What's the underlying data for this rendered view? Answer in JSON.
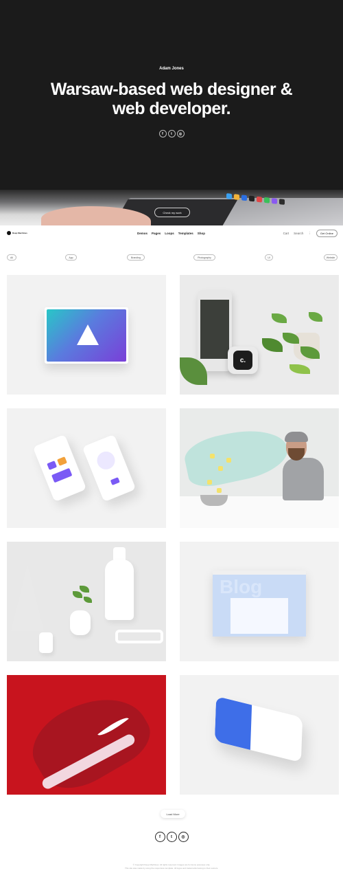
{
  "hero": {
    "name": "Adam Jones",
    "title_line1": "Warsaw-based web designer &",
    "title_line2": "web developer.",
    "social": [
      {
        "icon": "facebook-icon",
        "glyph": "f"
      },
      {
        "icon": "twitter-icon",
        "glyph": "t"
      },
      {
        "icon": "dribbble-icon",
        "glyph": "◎"
      }
    ],
    "cta_label": "Check my work"
  },
  "nav": {
    "logo_text": "Deep Machines",
    "menu": [
      "Demos",
      "Pages",
      "Loops",
      "Templates",
      "Shop"
    ],
    "cart": "Cart",
    "search": "Search",
    "more": "⋮",
    "contact": "Get Online"
  },
  "filters": [
    "All",
    "App",
    "Branding",
    "Photography",
    "UI",
    "Website"
  ],
  "portfolio": [
    {
      "id": "tablet-logo-mockup"
    },
    {
      "id": "phone-watch-plants"
    },
    {
      "id": "mobile-app-screens"
    },
    {
      "id": "man-with-popcorn"
    },
    {
      "id": "white-still-life"
    },
    {
      "id": "blog-website-mockup"
    },
    {
      "id": "red-sneaker"
    },
    {
      "id": "phone-app-mockup"
    }
  ],
  "see_more": "Load More",
  "footer": {
    "social": [
      {
        "icon": "facebook-icon",
        "glyph": "f"
      },
      {
        "icon": "twitter-icon",
        "glyph": "t"
      },
      {
        "icon": "dribbble-icon",
        "glyph": "◎"
      }
    ],
    "line1": "© Copyright Deep Machines. All rights reserved. Images are for demo purposes only.",
    "line2": "This site was made by using the responsive template. All logos and trademarks belong to their owners."
  },
  "colors": {
    "hero_bg": "#1b1b1b",
    "sneaker_bg": "#c8141e",
    "accent_purple": "#7a5af5",
    "accent_blue": "#3e6ee8"
  }
}
